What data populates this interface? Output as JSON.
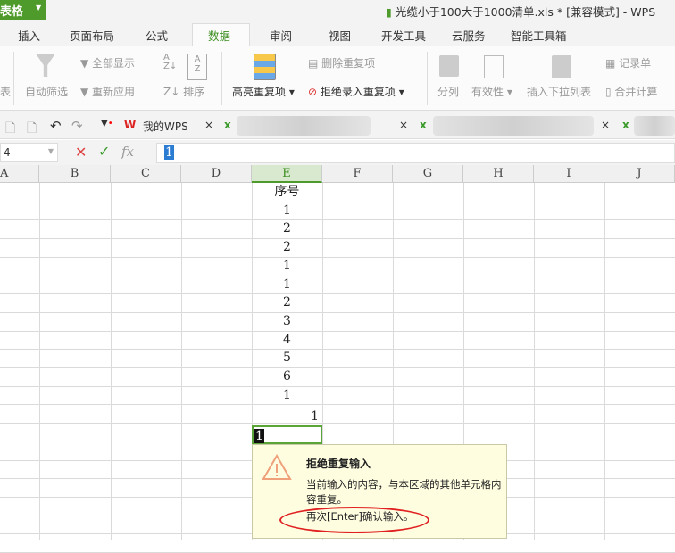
{
  "app": {
    "menu_button": "表格",
    "title": "光缆小于100大于1000清单.xls * [兼容模式] - WPS"
  },
  "menu_tabs": [
    "插入",
    "页面布局",
    "公式",
    "数据",
    "审阅",
    "视图",
    "开发工具",
    "云服务",
    "智能工具箱"
  ],
  "active_tab": "数据",
  "ribbon": {
    "partial_left": "表",
    "auto_filter": "自动筛选",
    "show_all": "全部显示",
    "reapply": "重新应用",
    "sort": "排序",
    "highlight_dup": "高亮重复项",
    "remove_dup": "删除重复项",
    "reject_dup": "拒绝录入重复项",
    "text_to_columns": "分列",
    "validity": "有效性",
    "insert_dropdown": "插入下拉列表",
    "record_form": "记录单",
    "consolidate": "合并计算"
  },
  "doc_tabs": {
    "my_wps": "我的WPS"
  },
  "formula_bar": {
    "name_box": "4",
    "value": "1"
  },
  "columns": [
    "A",
    "B",
    "C",
    "D",
    "E",
    "F",
    "G",
    "H",
    "I",
    "J"
  ],
  "column_e": {
    "header": "序号",
    "values": [
      "1",
      "2",
      "2",
      "1",
      "1",
      "2",
      "3",
      "4",
      "5",
      "6",
      "1"
    ],
    "right_aligned_value": "1",
    "editing_value": "1"
  },
  "popup": {
    "title": "拒绝重复输入",
    "message": "当前输入的内容，与本区域的其他单元格内容重复。",
    "confirm": "再次[Enter]确认输入。"
  },
  "colors": {
    "accent": "#4e9a2a",
    "popup_bg": "#fffde0",
    "highlight_ellipse": "#e02020"
  }
}
